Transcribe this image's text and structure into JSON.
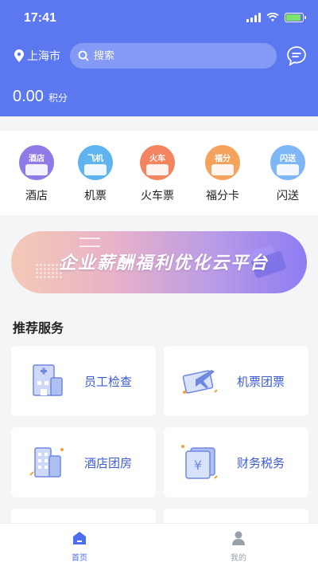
{
  "status_bar": {
    "time": "17:41"
  },
  "header": {
    "location": "上海市",
    "search_placeholder": "搜索",
    "points_value": "0.00",
    "points_unit": "积分"
  },
  "quick_services": [
    {
      "label": "酒店",
      "icon_tag": "酒店",
      "icon": "hotel-icon",
      "color": "#8f7ae8"
    },
    {
      "label": "机票",
      "icon_tag": "飞机",
      "icon": "plane-icon",
      "color": "#5fb4f0"
    },
    {
      "label": "火车票",
      "icon_tag": "火车",
      "icon": "train-icon",
      "color": "#f4845f"
    },
    {
      "label": "福分卡",
      "icon_tag": "福分",
      "icon": "gift-card-icon",
      "color": "#f5a35c"
    },
    {
      "label": "闪送",
      "icon_tag": "闪送",
      "icon": "flash-delivery-icon",
      "color": "#7fb6f6"
    }
  ],
  "banner": {
    "text": "企业薪酬福利优化云平台"
  },
  "recommend": {
    "title": "推荐服务",
    "items": [
      {
        "label": "员工检查",
        "icon": "medical-building-icon"
      },
      {
        "label": "机票团票",
        "icon": "plane-ticket-icon"
      },
      {
        "label": "酒店团房",
        "icon": "hotel-building-icon"
      },
      {
        "label": "财务税务",
        "icon": "finance-yen-icon"
      }
    ]
  },
  "tabbar": {
    "home": "首页",
    "mine": "我的",
    "active_color": "#4e6ef2",
    "inactive_color": "#9aa0aa"
  }
}
